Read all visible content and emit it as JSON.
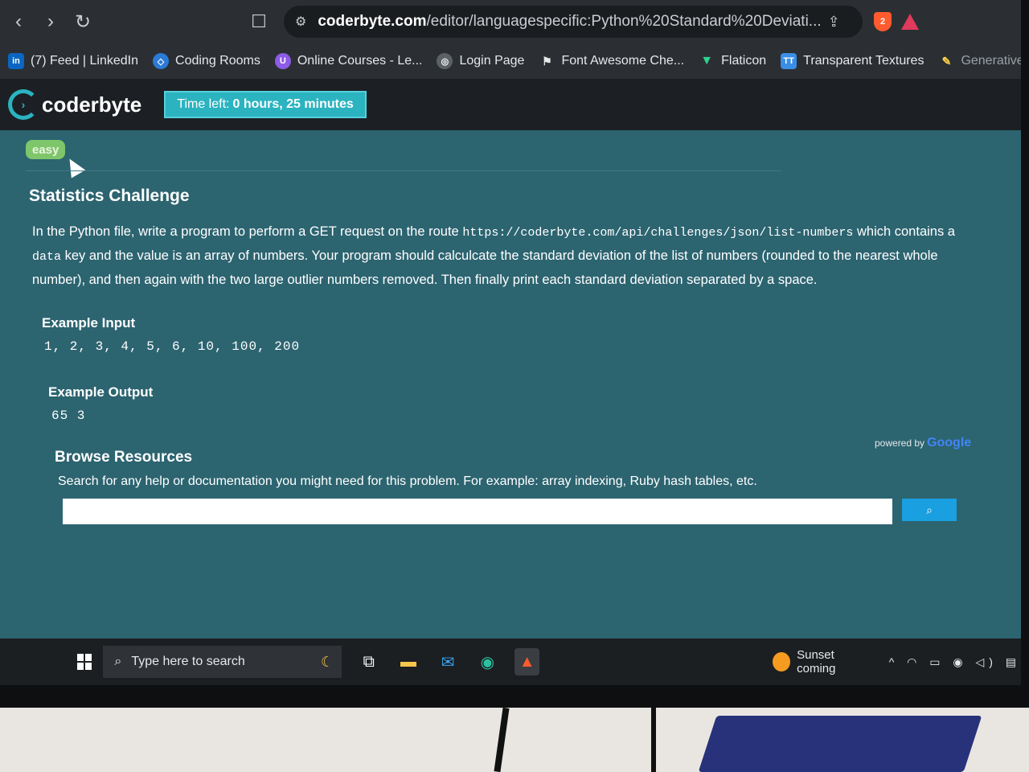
{
  "browser": {
    "url_domain": "coderbyte.com",
    "url_path": "/editor/languagespecific:Python%20Standard%20Deviati...",
    "shield_count": "2"
  },
  "bookmarks": [
    {
      "label": "(7) Feed | LinkedIn",
      "icon": "linkedin-icon",
      "badge": "in"
    },
    {
      "label": "Coding Rooms",
      "icon": "coding-rooms-icon",
      "badge": "◇"
    },
    {
      "label": "Online Courses - Le...",
      "icon": "udemy-icon",
      "badge": "U"
    },
    {
      "label": "Login Page",
      "icon": "globe-icon",
      "badge": "◎"
    },
    {
      "label": "Font Awesome Che...",
      "icon": "flag-icon",
      "badge": "⚑"
    },
    {
      "label": "Flaticon",
      "icon": "flaticon-icon",
      "badge": "▼"
    },
    {
      "label": "Transparent Textures",
      "icon": "tt-icon",
      "badge": "TT"
    },
    {
      "label": "Generative AI - Bizt...",
      "icon": "pen-icon",
      "badge": "✎"
    }
  ],
  "header": {
    "logo_text": "coderbyte",
    "timer_prefix": "Time left:",
    "timer_value": "0 hours, 25 minutes"
  },
  "challenge": {
    "difficulty": "easy",
    "title": "Statistics Challenge",
    "desc_1": "In the Python file, write a program to perform a GET request on the route ",
    "desc_url": "https://coderbyte.com/api/challenges/json/list-numbers",
    "desc_2": " which contains a ",
    "desc_key": "data",
    "desc_3": " key and the value is an array of numbers. Your program should calculcate the standard deviation of the list of numbers (rounded to the nearest whole number), and then again with the two large outlier numbers removed. Then finally print each standard deviation separated by a space.",
    "example_input_label": "Example Input",
    "example_input": "1, 2, 3, 4, 5, 6, 10, 100, 200",
    "example_output_label": "Example Output",
    "example_output": "65 3"
  },
  "resources": {
    "title": "Browse Resources",
    "description": "Search for any help or documentation you might need for this problem. For example: array indexing, Ruby hash tables, etc.",
    "powered_by": "powered by",
    "powered_brand": "Google",
    "search_placeholder": ""
  },
  "taskbar": {
    "search_placeholder": "Type here to search",
    "weather_text": "Sunset coming"
  },
  "colors": {
    "page_bg": "#2c6470",
    "accent": "#2bb3c0",
    "easy_badge": "#7fc66a",
    "search_button": "#1a9fe0"
  }
}
